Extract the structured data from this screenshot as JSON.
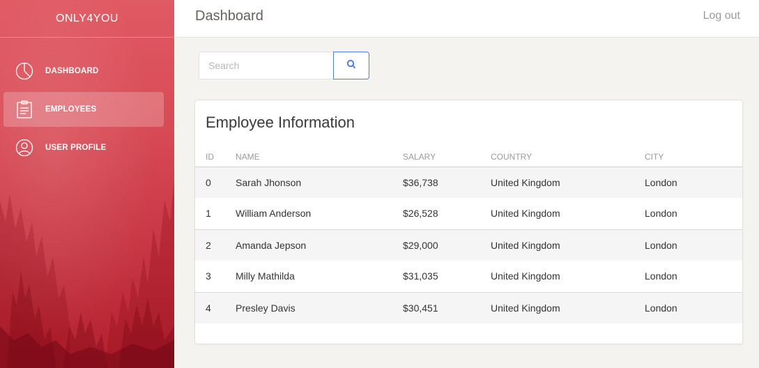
{
  "brand": "ONLY4YOU",
  "sidebar": {
    "items": [
      {
        "label": "DASHBOARD",
        "icon": "pie-chart-icon",
        "active": false
      },
      {
        "label": "EMPLOYEES",
        "icon": "clipboard-icon",
        "active": true
      },
      {
        "label": "USER PROFILE",
        "icon": "user-icon",
        "active": false
      }
    ]
  },
  "header": {
    "title": "Dashboard",
    "logout_label": "Log out"
  },
  "search": {
    "placeholder": "Search",
    "value": "",
    "button_icon": "search-icon"
  },
  "card": {
    "title": "Employee Information",
    "columns": [
      "ID",
      "NAME",
      "SALARY",
      "COUNTRY",
      "CITY"
    ],
    "rows": [
      {
        "id": "0",
        "name": "Sarah Jhonson",
        "salary": "$36,738",
        "country": "United Kingdom",
        "city": "London"
      },
      {
        "id": "1",
        "name": "William Anderson",
        "salary": "$26,528",
        "country": "United Kingdom",
        "city": "London"
      },
      {
        "id": "2",
        "name": "Amanda Jepson",
        "salary": "$29,000",
        "country": "United Kingdom",
        "city": "London"
      },
      {
        "id": "3",
        "name": "Milly Mathilda",
        "salary": "$31,035",
        "country": "United Kingdom",
        "city": "London"
      },
      {
        "id": "4",
        "name": "Presley Davis",
        "salary": "$30,451",
        "country": "United Kingdom",
        "city": "London"
      }
    ]
  },
  "colors": {
    "sidebar_top": "#e05a63",
    "sidebar_bottom": "#b3202d",
    "search_button_border": "#4a7fe0",
    "page_background": "#f4f3ef"
  }
}
